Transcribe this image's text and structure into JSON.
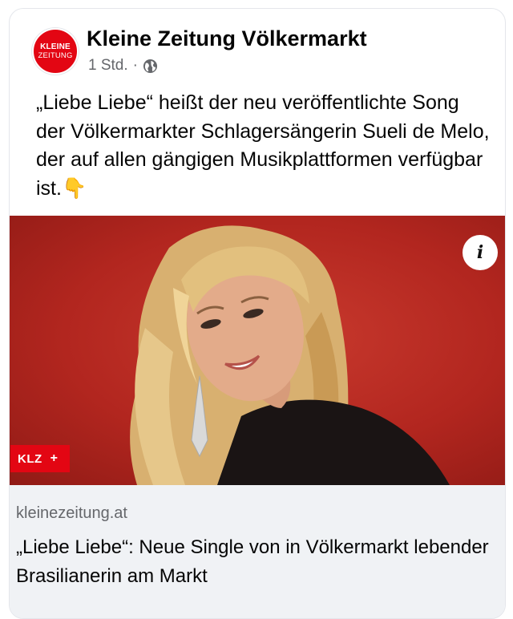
{
  "post": {
    "page_name": "Kleine Zeitung Völkermarkt",
    "avatar_line1": "KLEINE",
    "avatar_line2": "ZEITUNG",
    "time": "1 Std.",
    "separator": "·",
    "privacy_icon": "globe-icon",
    "text": "„Liebe Liebe“ heißt der neu veröffentlichte Song der Völkermarkter Schlagersängerin Sueli de Melo, der auf allen gängigen Musikplattformen verfügbar ist.",
    "pointer_emoji": "👇"
  },
  "media": {
    "info_label": "i",
    "badge_text": "KLZ",
    "badge_plus": "+",
    "background_color": "#b2261f"
  },
  "link": {
    "domain": "kleinezeitung.at",
    "title": "„Liebe Liebe“: Neue Single von in Völkermarkt lebender Brasilianerin am Markt"
  },
  "colors": {
    "brand_red": "#e30613",
    "secondary_text": "#65676b",
    "link_bg": "#f0f2f5"
  }
}
